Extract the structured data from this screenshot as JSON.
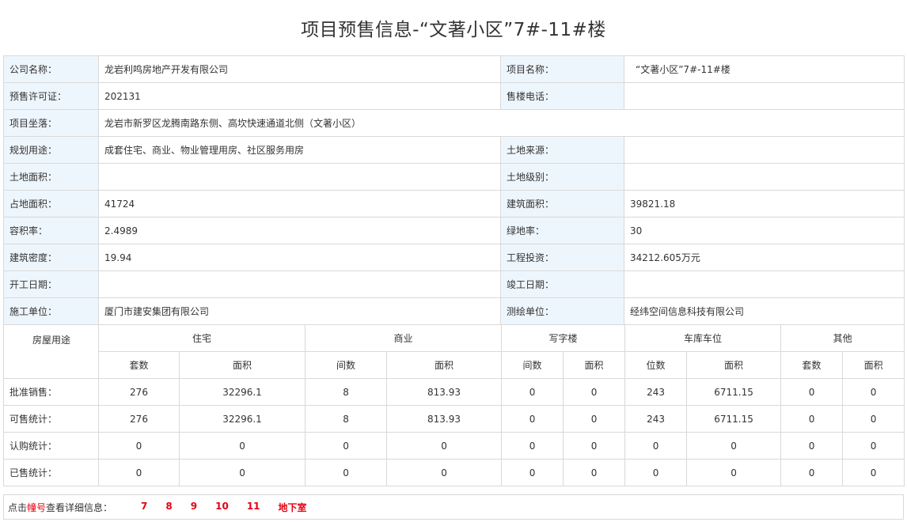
{
  "page": {
    "title": "项目预售信息-“文著小区”7#-11#楼"
  },
  "info": {
    "company_label": "公司名称：",
    "company": "龙岩利鸣房地产开发有限公司",
    "project_label": "项目名称：",
    "project": "“文著小区”7#-11#楼",
    "permit_label": "预售许可证：",
    "permit": "202131",
    "phone_label": "售楼电话：",
    "phone": "",
    "location_label": "项目坐落：",
    "location": "龙岩市新罗区龙腾南路东侧、高坎快速通道北侧（文著小区）",
    "usage_label": "规划用途：",
    "usage": "成套住宅、商业、物业管理用房、社区服务用房",
    "land_source_label": "土地来源：",
    "land_source": "",
    "land_area_label": "土地面积：",
    "land_area": "",
    "land_level_label": "土地级别：",
    "land_level": "",
    "site_area_label": "占地面积：",
    "site_area": "41724",
    "building_area_label": "建筑面积：",
    "building_area": "39821.18",
    "far_label": "容积率：",
    "far": "2.4989",
    "green_label": "绿地率：",
    "green": "30",
    "density_label": "建筑密度：",
    "density": "19.94",
    "investment_label": "工程投资：",
    "investment": "34212.605万元",
    "start_label": "开工日期：",
    "start": "",
    "finish_label": "竣工日期：",
    "finish": "",
    "builder_label": "施工单位：",
    "builder": "厦门市建安集团有限公司",
    "surveyor_label": "测绘单位：",
    "surveyor": "经纬空间信息科技有限公司"
  },
  "stats": {
    "corner": "房屋用途",
    "groups": [
      "住宅",
      "商业",
      "写字楼",
      "车库车位",
      "其他"
    ],
    "subheaders": [
      "套数",
      "面积",
      "间数",
      "面积",
      "间数",
      "面积",
      "位数",
      "面积",
      "套数",
      "面积"
    ],
    "rows": [
      {
        "label": "批准销售：",
        "values": [
          "276",
          "32296.1",
          "8",
          "813.93",
          "0",
          "0",
          "243",
          "6711.15",
          "0",
          "0"
        ]
      },
      {
        "label": "可售统计：",
        "values": [
          "276",
          "32296.1",
          "8",
          "813.93",
          "0",
          "0",
          "243",
          "6711.15",
          "0",
          "0"
        ]
      },
      {
        "label": "认购统计：",
        "values": [
          "0",
          "0",
          "0",
          "0",
          "0",
          "0",
          "0",
          "0",
          "0",
          "0"
        ]
      },
      {
        "label": "已售统计：",
        "values": [
          "0",
          "0",
          "0",
          "0",
          "0",
          "0",
          "0",
          "0",
          "0",
          "0"
        ]
      }
    ]
  },
  "footer": {
    "hint_prefix": "点击",
    "hint_red": "幢号",
    "hint_suffix": "查看详细信息：",
    "buildings": [
      "7",
      "8",
      "9",
      "10",
      "11",
      "地下室"
    ]
  },
  "colors": {
    "label_bg": "#eef6fd",
    "border": "#d9d9d9",
    "link_red": "#e60012"
  }
}
